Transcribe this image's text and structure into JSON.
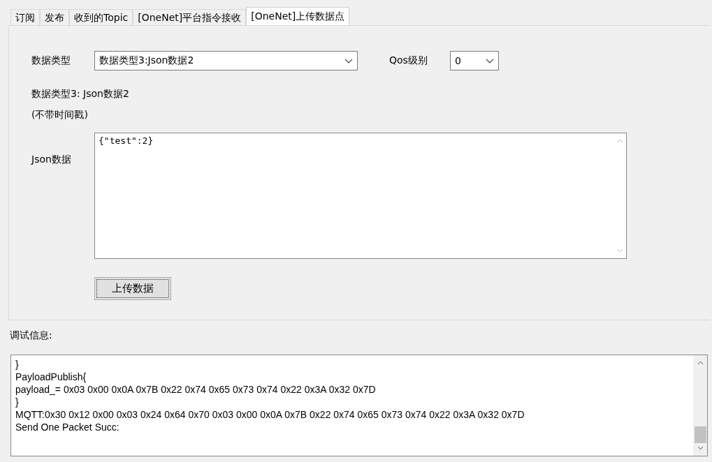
{
  "tabs": [
    {
      "label": "订阅",
      "selected": false
    },
    {
      "label": "发布",
      "selected": false
    },
    {
      "label": "收到的Topic",
      "selected": false
    },
    {
      "label": "[OneNet]平台指令接收",
      "selected": false
    },
    {
      "label": "[OneNet]上传数据点",
      "selected": true
    }
  ],
  "data_type": {
    "label": "数据类型",
    "value": "数据类型3:Json数据2"
  },
  "qos": {
    "label": "Qos级别",
    "value": "0"
  },
  "description": [
    "数据类型3: Json数据2",
    "(不带时间戳)"
  ],
  "json_data": {
    "label": "Json数据",
    "value": "{\"test\":2}"
  },
  "upload_button": "上传数据",
  "debug": {
    "label": "调试信息:",
    "lines": [
      "}",
      "PayloadPublish{",
      "payload_= 0x03 0x00 0x0A 0x7B 0x22 0x74 0x65 0x73 0x74 0x22 0x3A 0x32 0x7D",
      "}",
      "MQTT:0x30 0x12 0x00 0x03 0x24 0x64 0x70 0x03 0x00 0x0A 0x7B 0x22 0x74 0x65 0x73 0x74 0x22 0x3A 0x32 0x7D",
      "Send One Packet Succ:"
    ]
  }
}
